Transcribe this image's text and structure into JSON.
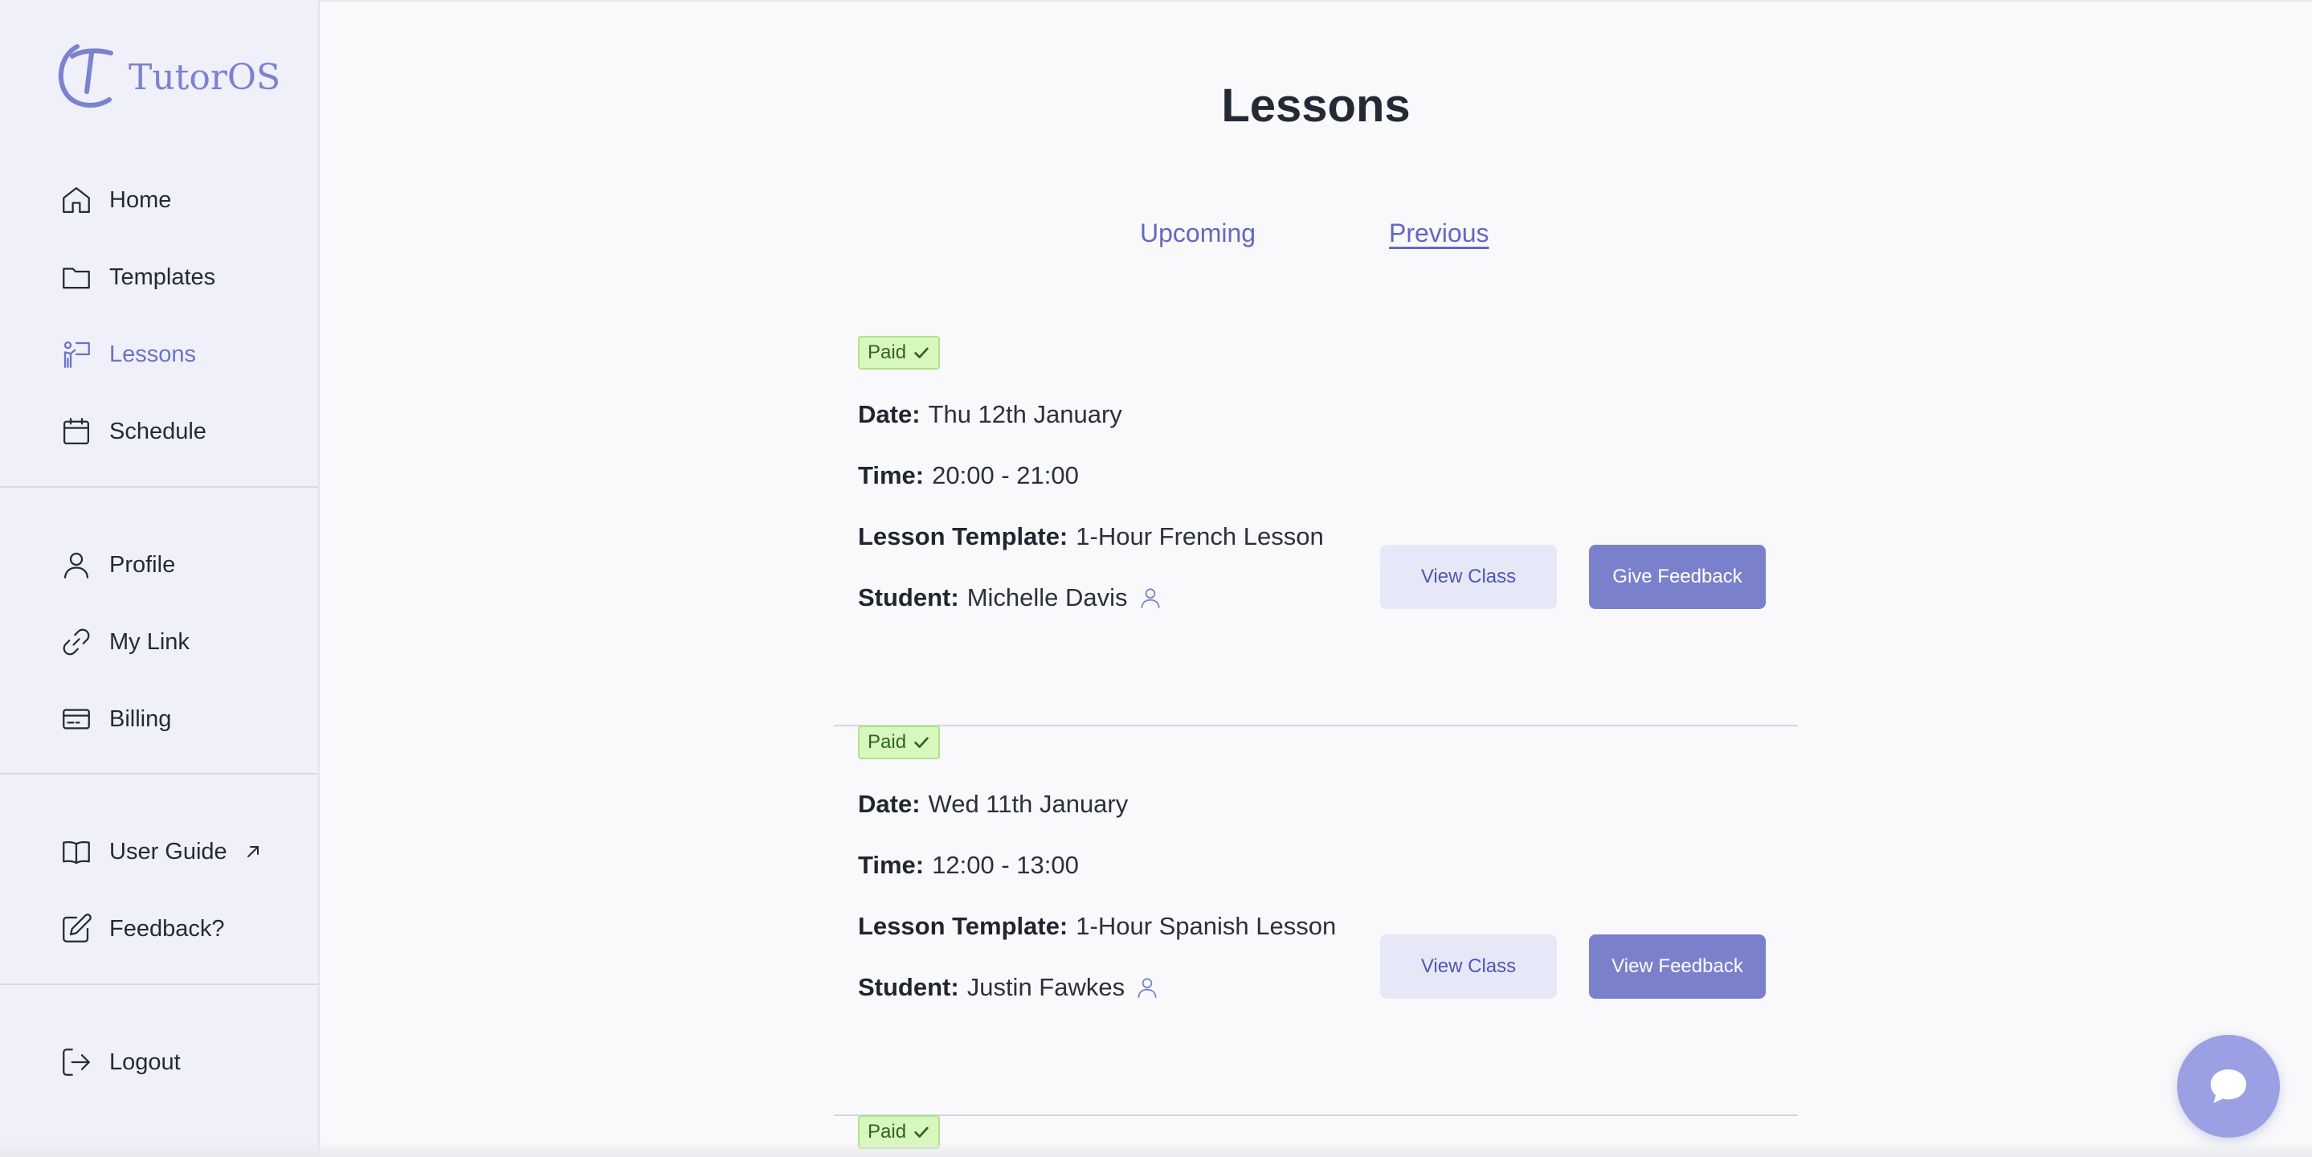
{
  "app": {
    "name": "TutorOS"
  },
  "sidebar": {
    "primary": [
      {
        "label": "Home",
        "icon": "home-icon"
      },
      {
        "label": "Templates",
        "icon": "folder-icon"
      },
      {
        "label": "Lessons",
        "icon": "teacher-board-icon",
        "active": true
      },
      {
        "label": "Schedule",
        "icon": "calendar-icon"
      }
    ],
    "account": [
      {
        "label": "Profile",
        "icon": "user-icon"
      },
      {
        "label": "My Link",
        "icon": "link-icon"
      },
      {
        "label": "Billing",
        "icon": "credit-card-icon"
      }
    ],
    "help": [
      {
        "label": "User Guide",
        "icon": "book-icon",
        "external_icon": "external-link-icon"
      },
      {
        "label": "Feedback?",
        "icon": "edit-icon"
      }
    ],
    "session": [
      {
        "label": "Logout",
        "icon": "logout-icon"
      }
    ]
  },
  "main": {
    "title": "Lessons",
    "tabs": [
      {
        "label": "Upcoming",
        "selected": false
      },
      {
        "label": "Previous",
        "selected": true
      }
    ],
    "field_labels": {
      "date": "Date:",
      "time": "Time:",
      "template": "Lesson Template:",
      "student": "Student:"
    },
    "lessons": [
      {
        "status": "Paid",
        "date": "Thu 12th January",
        "time": "20:00 - 21:00",
        "template": "1-Hour French Lesson",
        "student": "Michelle Davis",
        "primary_button": "View Class",
        "secondary_button": "Give Feedback"
      },
      {
        "status": "Paid",
        "date": "Wed 11th January",
        "time": "12:00 - 13:00",
        "template": "1-Hour Spanish Lesson",
        "student": "Justin Fawkes",
        "primary_button": "View Class",
        "secondary_button": "View Feedback"
      },
      {
        "status": "Paid"
      }
    ]
  },
  "colors": {
    "accent": "#6b72c9",
    "button": "#7b80cc",
    "sidebar_bg": "#eff0fa",
    "paid_badge": "#d7f7bd"
  },
  "chat": {
    "icon": "chat-bubble-icon"
  }
}
